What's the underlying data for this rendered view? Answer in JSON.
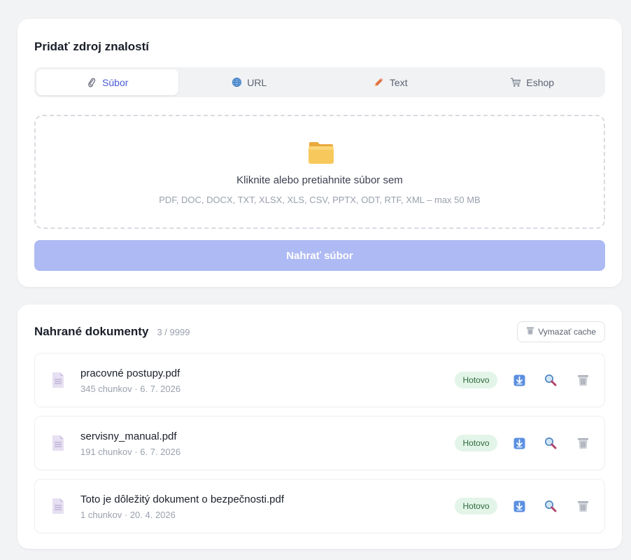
{
  "add_source": {
    "title": "Pridať zdroj znalostí",
    "tabs": [
      {
        "label": "Súbor",
        "icon": "paperclip-icon",
        "active": true
      },
      {
        "label": "URL",
        "icon": "globe-icon",
        "active": false
      },
      {
        "label": "Text",
        "icon": "pencil-icon",
        "active": false
      },
      {
        "label": "Eshop",
        "icon": "cart-icon",
        "active": false
      }
    ],
    "dropzone": {
      "icon": "folder-icon",
      "main_text": "Kliknite alebo pretiahnite súbor sem",
      "hint": "PDF, DOC, DOCX, TXT, XLSX, XLS, CSV, PPTX, ODT, RTF, XML – max 50 MB"
    },
    "upload_button": "Nahrať súbor"
  },
  "documents": {
    "title": "Nahrané dokumenty",
    "count": "3 / 9999",
    "clear_cache_button": "Vymazať cache",
    "items": [
      {
        "name": "pracovné postupy.pdf",
        "meta": "345 chunkov · 6. 7. 2026",
        "status": "Hotovo"
      },
      {
        "name": "servisny_manual.pdf",
        "meta": "191 chunkov · 6. 7. 2026",
        "status": "Hotovo"
      },
      {
        "name": "Toto je dôležitý dokument o bezpečnosti.pdf",
        "meta": "1 chunkov · 20. 4. 2026",
        "status": "Hotovo"
      }
    ]
  },
  "colors": {
    "accent": "#4a5bd6",
    "upload_button_bg": "#aebaf3",
    "status_badge_bg": "#e3f5e8",
    "status_badge_text": "#2c6a3e"
  }
}
